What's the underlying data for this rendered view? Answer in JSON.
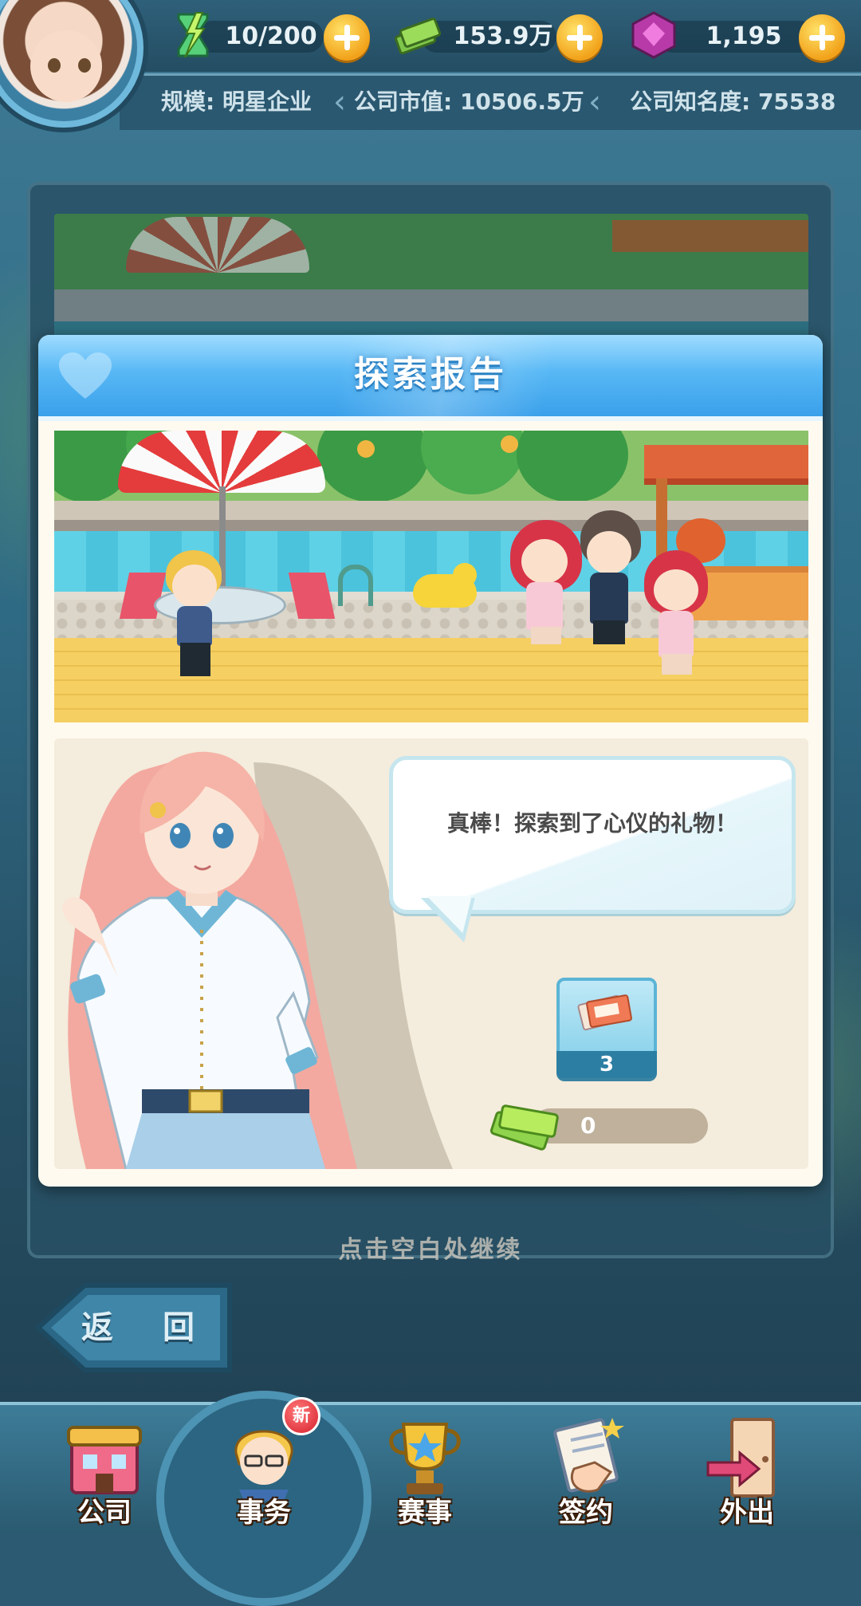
{
  "hud": {
    "stamina": "10/200",
    "cash": "153.9万",
    "gems": "1,195",
    "company_scale": "规模: 明星企业",
    "company_value": "公司市值: 10506.5万",
    "company_fame": "公司知名度: 75538"
  },
  "modal": {
    "title": "探索报告",
    "message": "真棒！探索到了心仪的礼物！",
    "reward_item_count": "3",
    "reward_item_icon": "ticket-icon",
    "reward_cash": "0",
    "reward_cash_icon": "cash-stack-icon"
  },
  "continue_hint": "点击空白处继续",
  "back_button": {
    "label": "返 回"
  },
  "nav": {
    "items": [
      {
        "label": "公司",
        "icon": "company-building-icon"
      },
      {
        "label": "事务",
        "icon": "manager-avatar-icon",
        "badge": "新"
      },
      {
        "label": "赛事",
        "icon": "trophy-icon"
      },
      {
        "label": "签约",
        "icon": "contract-icon"
      },
      {
        "label": "外出",
        "icon": "door-exit-icon"
      }
    ]
  },
  "colors": {
    "modal_header": "#58b8f5",
    "plus_button": "#f2a21a",
    "nav_background": "#2a5a70"
  }
}
